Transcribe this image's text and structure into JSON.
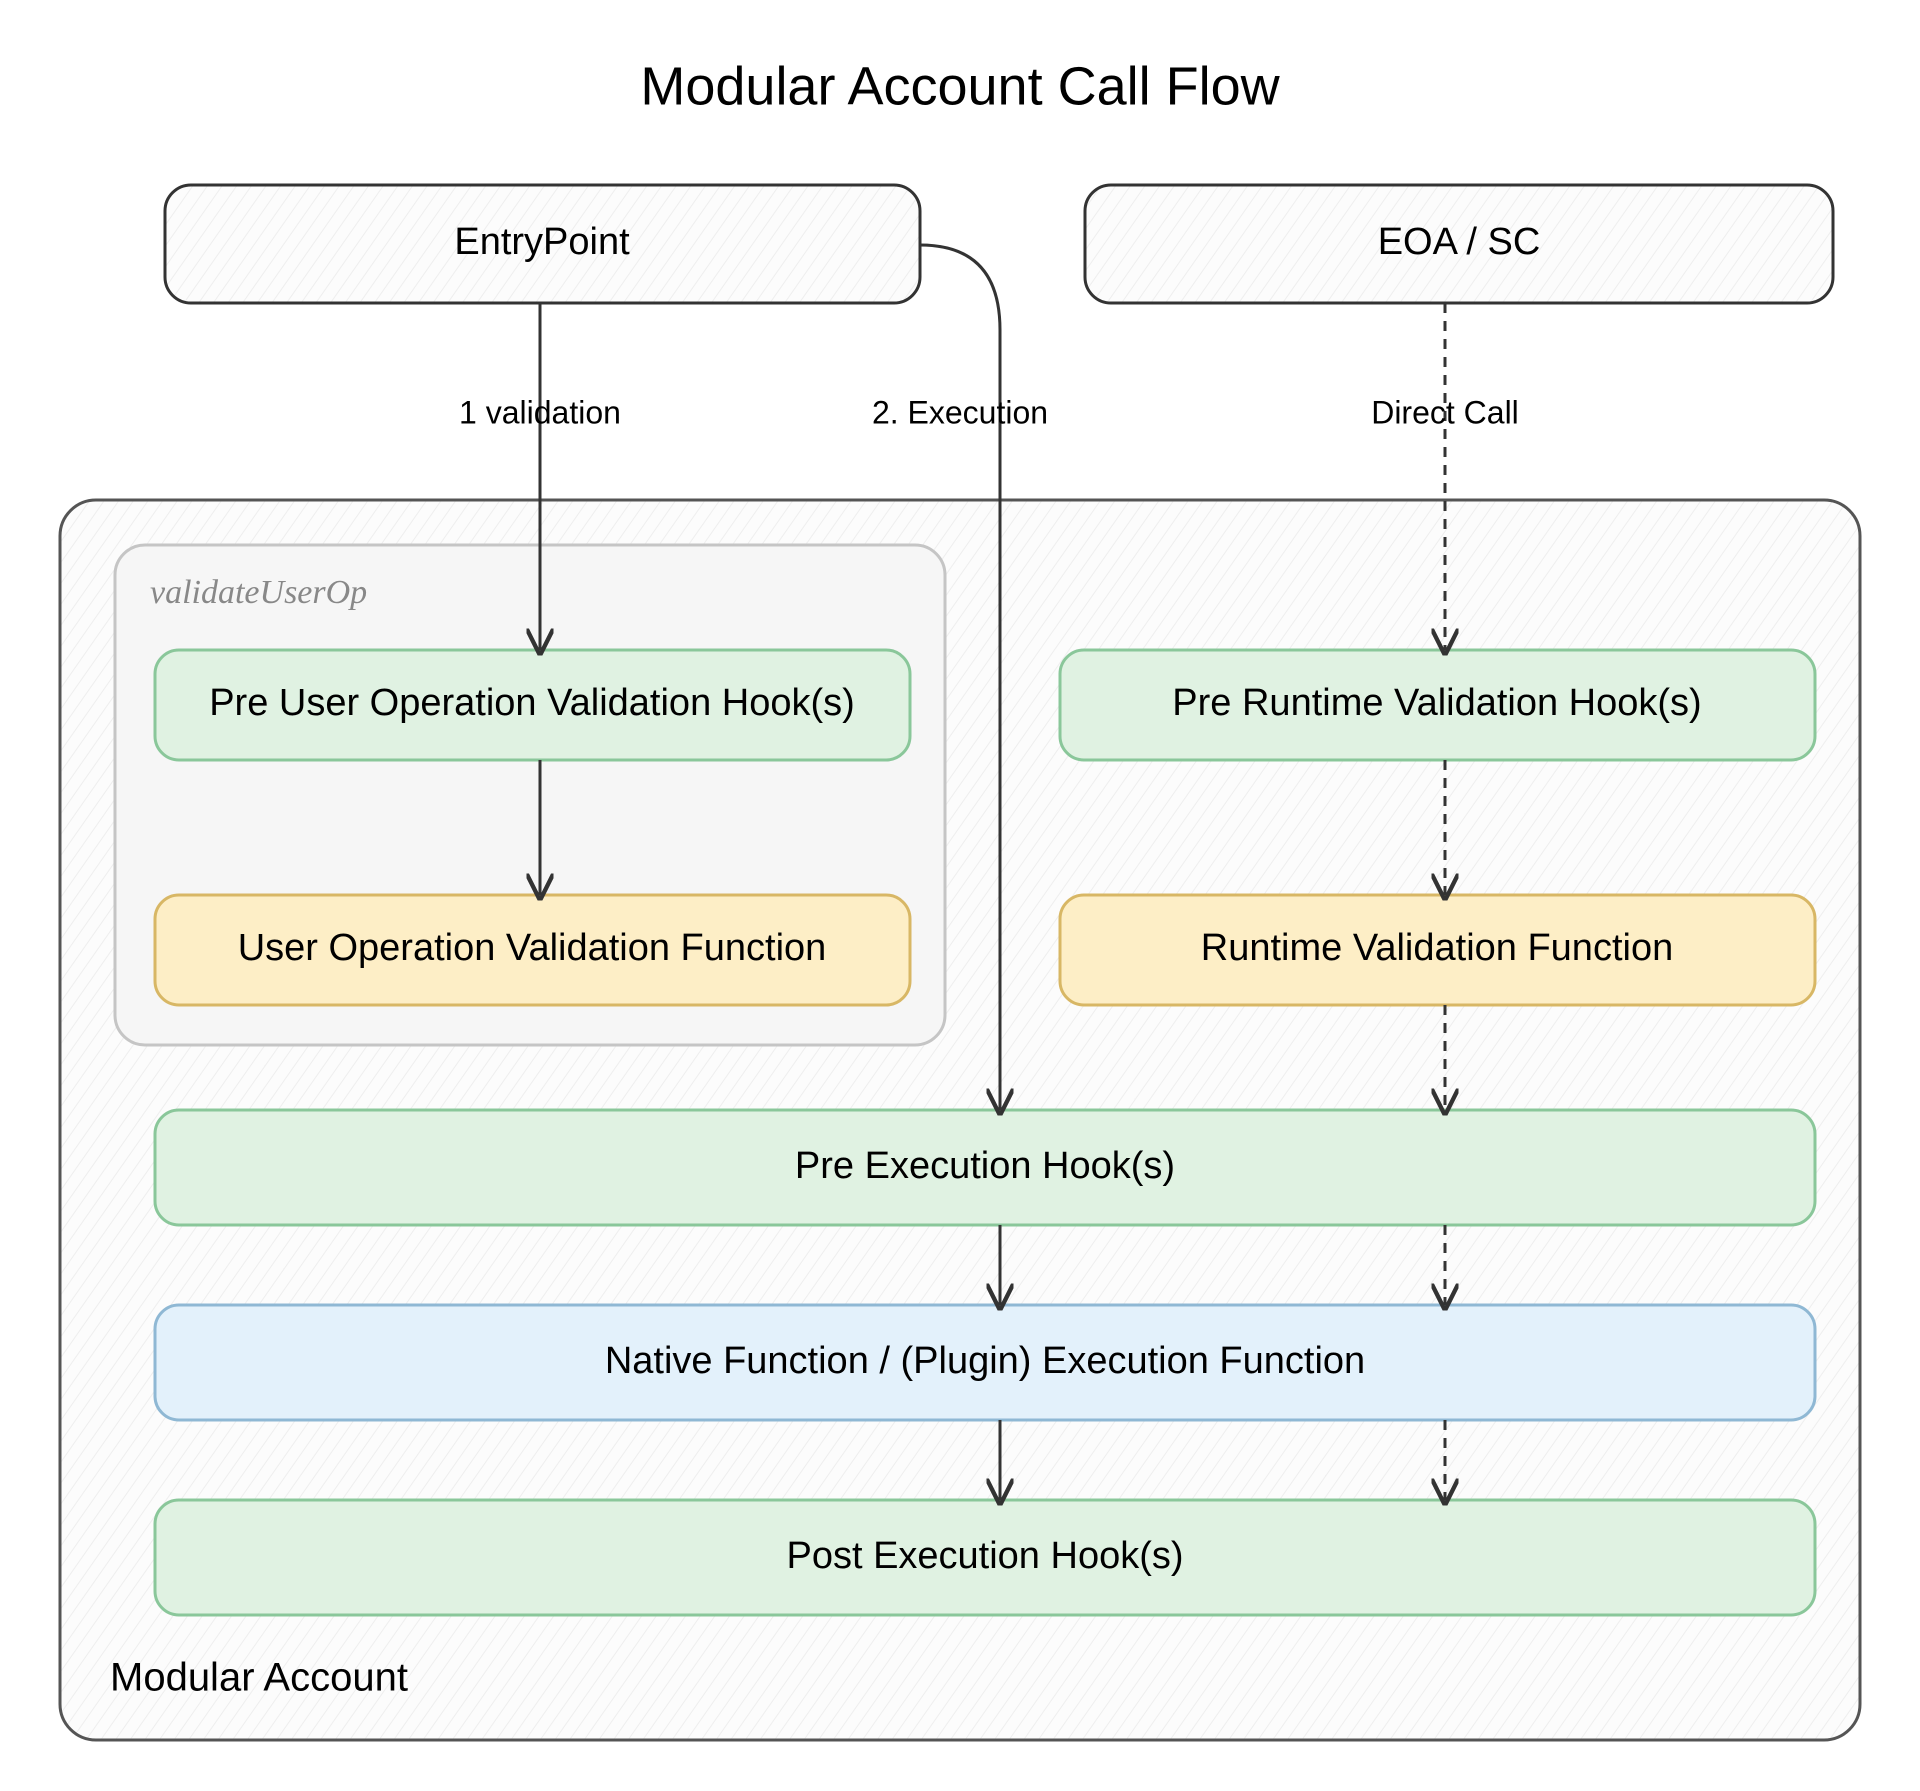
{
  "title": "Modular Account Call Flow",
  "colors": {
    "green": "#e0f2e2",
    "greenStroke": "#8ac79a",
    "yellow": "#fdeec6",
    "yellowStroke": "#d8b765",
    "blue": "#e3f1fb",
    "blueStroke": "#8fb8d4",
    "grey": "#f0f0f0",
    "greyStroke": "#555555",
    "hatch": "#f7f7f7",
    "line": "#333333"
  },
  "boxes": {
    "entrypoint": "EntryPoint",
    "eoa": "EOA / SC",
    "preUserOp": "Pre User Operation Validation Hook(s)",
    "userOpVal": "User Operation Validation Function",
    "preRuntime": "Pre Runtime Validation Hook(s)",
    "runtimeVal": "Runtime Validation Function",
    "preExec": "Pre Execution Hook(s)",
    "native": "Native Function  /  (Plugin) Execution Function",
    "postExec": "Post Execution Hook(s)"
  },
  "groups": {
    "validateUserOp": "validateUserOp",
    "modular": "Modular Account"
  },
  "edges": {
    "validation": "1 validation",
    "execution": "2. Execution",
    "direct": "Direct Call"
  }
}
